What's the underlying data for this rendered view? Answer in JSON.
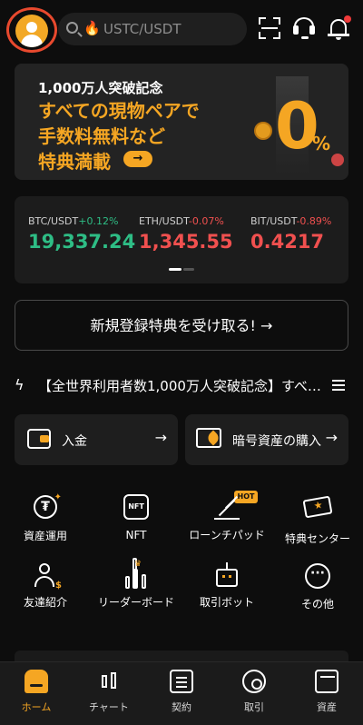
{
  "header": {
    "search": {
      "query": "USTC/USDT"
    },
    "icons": [
      "avatar",
      "search-icon",
      "flame-icon",
      "scan-icon",
      "headset-icon",
      "bell-icon"
    ]
  },
  "banner": {
    "subtitle": "1,000万人突破記念",
    "line1": "すべての現物ペアで",
    "line2": "手数料無料など",
    "line3": "特典満載",
    "arrow": "→",
    "big_number": "0",
    "percent": "%"
  },
  "tickers": [
    {
      "pair": "BTC/USDT",
      "change": "+0.12%",
      "price": "19,337.24",
      "direction": "up"
    },
    {
      "pair": "ETH/USDT",
      "change": "-0.07%",
      "price": "1,345.55",
      "direction": "down"
    },
    {
      "pair": "BIT/USDT",
      "change": "-0.89%",
      "price": "0.4217",
      "direction": "down"
    }
  ],
  "register": {
    "label": "新規登録特典を受け取る! →"
  },
  "announcement": {
    "text": "【全世界利用者数1,000万人突破記念】すべ…"
  },
  "quick": {
    "deposit": {
      "label": "入金",
      "arrow": "→"
    },
    "buy": {
      "label": "暗号資産の購入",
      "arrow": "→"
    }
  },
  "features": [
    {
      "label": "資産運用"
    },
    {
      "label": "NFT",
      "icon_text": "NFT"
    },
    {
      "label": "ローンチパッド",
      "badge": "HOT"
    },
    {
      "label": "特典センター"
    },
    {
      "label": "友達紹介"
    },
    {
      "label": "リーダーボード"
    },
    {
      "label": "取引ボット"
    },
    {
      "label": "その他",
      "icon_text": "···"
    }
  ],
  "bottom_nav": [
    {
      "label": "ホーム",
      "active": true
    },
    {
      "label": "チャート"
    },
    {
      "label": "契約"
    },
    {
      "label": "取引"
    },
    {
      "label": "資産"
    }
  ],
  "colors": {
    "accent": "#f5a623",
    "up": "#2ebd85",
    "down": "#f0504f",
    "background": "#0d0d0d"
  }
}
